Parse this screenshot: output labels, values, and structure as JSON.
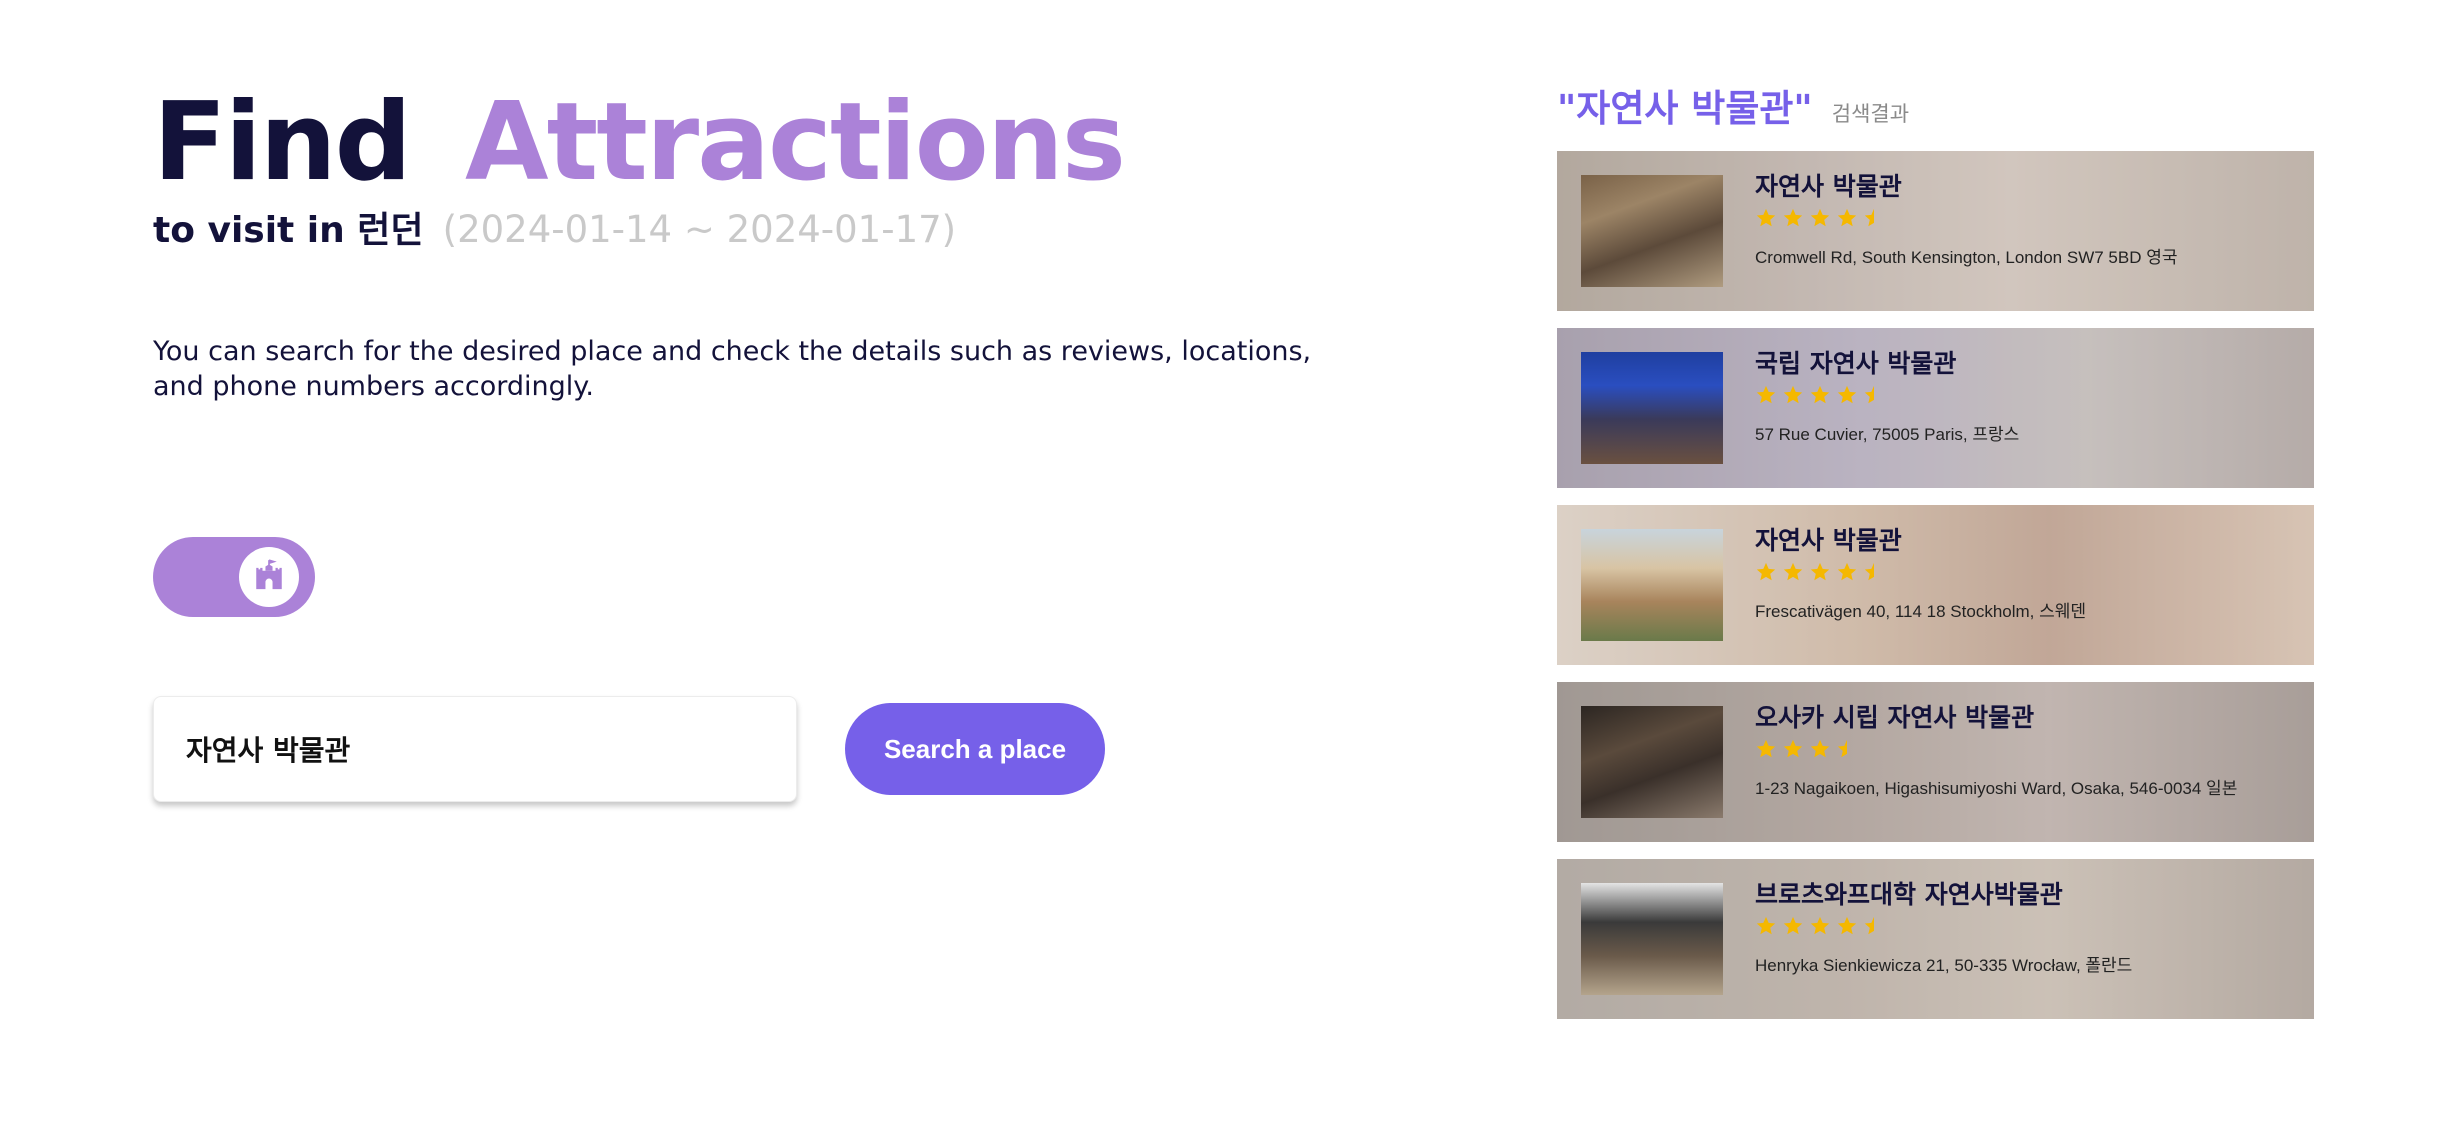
{
  "hero": {
    "title_part1": "Find",
    "title_part2": "Attractions",
    "subtitle": "to visit in 런던",
    "dates": "(2024-01-14 ~ 2024-01-17)",
    "description": "You can search for the desired place and check the details such as reviews, locations, and phone numbers accordingly."
  },
  "toggle": {
    "icon": "castle-icon",
    "on": true
  },
  "search": {
    "value": "자연사 박물관",
    "button_label": "Search a place"
  },
  "results": {
    "query": "\"자연사 박물관\"",
    "label": "검색결과",
    "items": [
      {
        "name": "자연사 박물관",
        "rating": 4.5,
        "address": "Cromwell Rd, South Kensington, London SW7 5BD 영국"
      },
      {
        "name": "국립 자연사 박물관",
        "rating": 4.5,
        "address": "57 Rue Cuvier, 75005 Paris, 프랑스"
      },
      {
        "name": "자연사 박물관",
        "rating": 4.5,
        "address": "Frescativägen 40, 114 18 Stockholm, 스웨덴"
      },
      {
        "name": "오사카 시립 자연사 박물관",
        "rating": 3.5,
        "address": "1-23 Nagaikoen, Higashisumiyoshi Ward, Osaka, 546-0034 일본"
      },
      {
        "name": "브로츠와프대학 자연사박물관",
        "rating": 4.5,
        "address": "Henryka Sienkiewicza 21, 50-335 Wrocław, 폴란드"
      }
    ]
  },
  "colors": {
    "accent_purple": "#ab82d8",
    "button_purple": "#7660e9",
    "dark_navy": "#13123a",
    "star_yellow": "#f5b800",
    "muted_gray": "#c9c9c9"
  }
}
